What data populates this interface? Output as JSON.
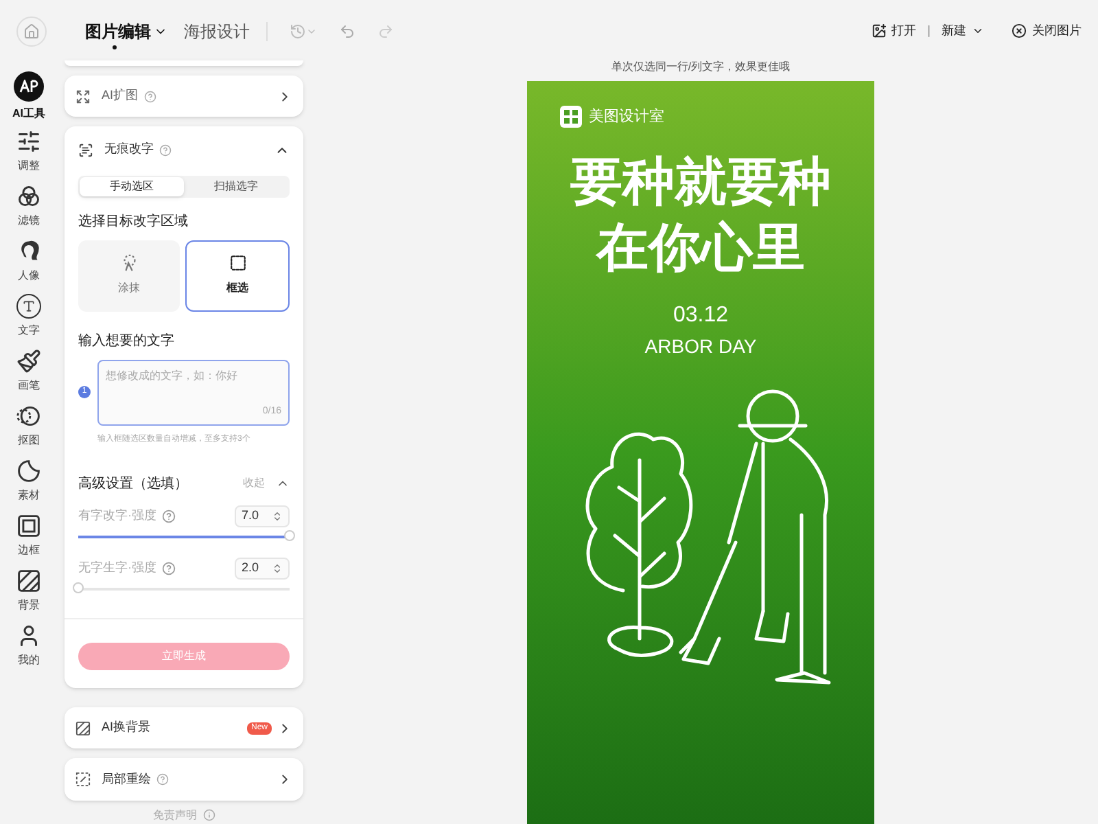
{
  "top_bar": {
    "tabs": [
      {
        "label": "图片编辑",
        "selected": true,
        "dropdown": true
      },
      {
        "label": "海报设计",
        "selected": false,
        "dropdown": false
      }
    ],
    "open": "打开",
    "separator": "|",
    "new": "新建",
    "close": "关闭图片"
  },
  "rail": [
    {
      "label": "AI工具",
      "kind": "ai",
      "selected": true
    },
    {
      "label": "调整",
      "kind": "adjust",
      "selected": false
    },
    {
      "label": "滤镜",
      "kind": "filter",
      "selected": false
    },
    {
      "label": "人像",
      "kind": "portrait",
      "selected": false
    },
    {
      "label": "文字",
      "kind": "text",
      "selected": false
    },
    {
      "label": "画笔",
      "kind": "brush",
      "selected": false
    },
    {
      "label": "抠图",
      "kind": "cutout",
      "selected": false
    },
    {
      "label": "素材",
      "kind": "sticker",
      "selected": false
    },
    {
      "label": "边框",
      "kind": "frame",
      "selected": false
    },
    {
      "label": "背景",
      "kind": "background",
      "selected": false
    },
    {
      "label": "我的",
      "kind": "user",
      "selected": false
    }
  ],
  "panel": {
    "expand_card": {
      "title": "AI扩图"
    },
    "erase_card": {
      "title": "无痕改字",
      "expanded": true,
      "modes": [
        {
          "label": "手动选区",
          "selected": true
        },
        {
          "label": "扫描选字",
          "selected": false
        }
      ],
      "area_title": "选择目标改字区域",
      "tools": [
        {
          "label": "涂抹",
          "kind": "smear",
          "selected": false
        },
        {
          "label": "框选",
          "kind": "box",
          "selected": true
        }
      ],
      "input_title": "输入想要的文字",
      "inputs": [
        {
          "index": "1",
          "placeholder": "想修改成的文字，如：你好",
          "counter": "0/16"
        }
      ],
      "input_hint": "输入框随选区数量自动增减，至多支持3个",
      "advanced": {
        "title": "高级设置（选填）",
        "collapse": "收起",
        "expanded": true,
        "sliders": [
          {
            "label": "有字改字·强度",
            "value": "7.0",
            "level": 1.0
          },
          {
            "label": "无字生字·强度",
            "value": "2.0",
            "level": 0.0
          }
        ]
      },
      "generate": {
        "label": "立即生成",
        "disabled": true
      }
    },
    "bg_card": {
      "title": "AI换背景",
      "badge": "New"
    },
    "repaint_card": {
      "title": "局部重绘"
    },
    "disclaimer": "免责声明"
  },
  "canvas": {
    "hint": "单次仅选同一行/列文字，效果更佳哦",
    "poster": {
      "brand": "美图设计室",
      "headline": [
        "要种就要种",
        "在你心里"
      ],
      "date": "03.12",
      "event": "ARBOR DAY"
    }
  }
}
